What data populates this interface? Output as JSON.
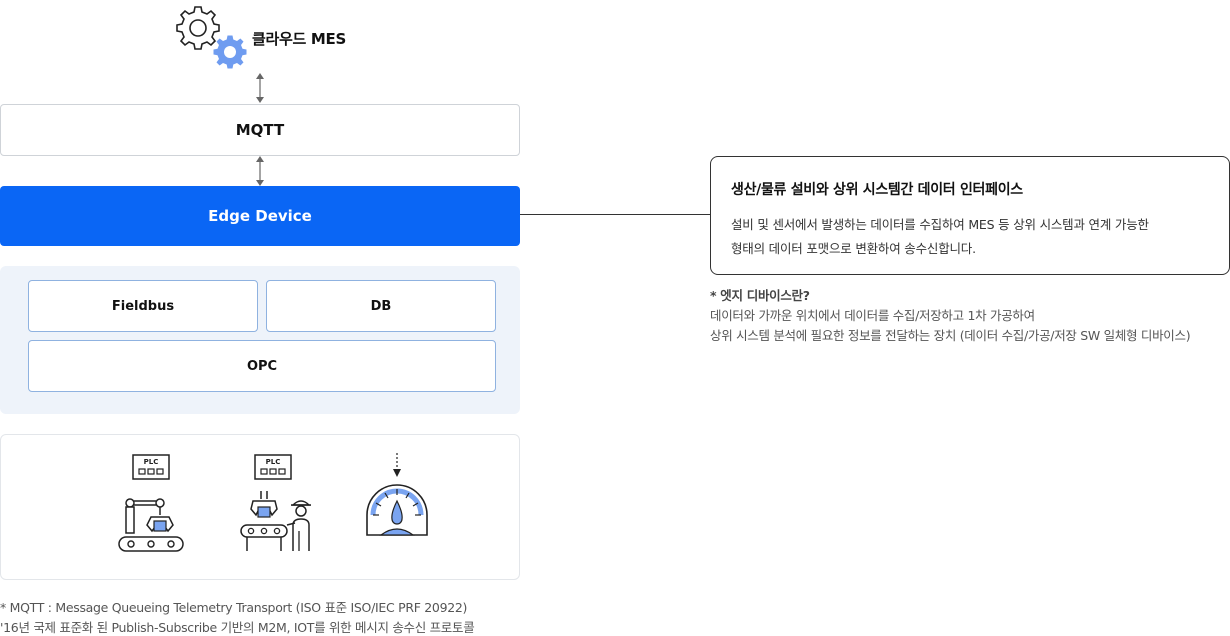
{
  "cloud": {
    "label": "클라우드 MES",
    "icon": "gears-icon"
  },
  "mqtt": {
    "label": "MQTT"
  },
  "edge": {
    "label": "Edge Device",
    "color": "#0a66f5"
  },
  "protocols": {
    "fieldbus": "Fieldbus",
    "db": "DB",
    "opc": "OPC"
  },
  "devices": {
    "plc_label": "PLC",
    "items": [
      "robot-arm-conveyor-icon",
      "worker-conveyor-icon",
      "gauge-meter-icon"
    ],
    "accent": "#7aa4f0"
  },
  "callout": {
    "title": "생산/물류 설비와 상위 시스템간 데이터 인터페이스",
    "desc_line1": "설비 및 센서에서 발생하는 데이터를 수집하여 MES 등 상위 시스템과 연계 가능한",
    "desc_line2": "형태의 데이터 포맷으로 변환하여 송수신합니다."
  },
  "edge_note": {
    "title": "* 엣지 디바이스란?",
    "line1": "데이터와 가까운 위치에서 데이터를 수집/저장하고 1차 가공하여",
    "line2": "상위 시스템 분석에 필요한 정보를 전달하는 장치 (데이터 수집/가공/저장 SW 일체형 디바이스)"
  },
  "footnote": {
    "line1": "* MQTT : Message Queueing Telemetry Transport (ISO 표준 ISO/IEC PRF 20922)",
    "line2": "'16년 국제 표준화 된 Publish-Subscribe 기반의 M2M, IOT를 위한 메시지 송수신 프로토콜"
  }
}
